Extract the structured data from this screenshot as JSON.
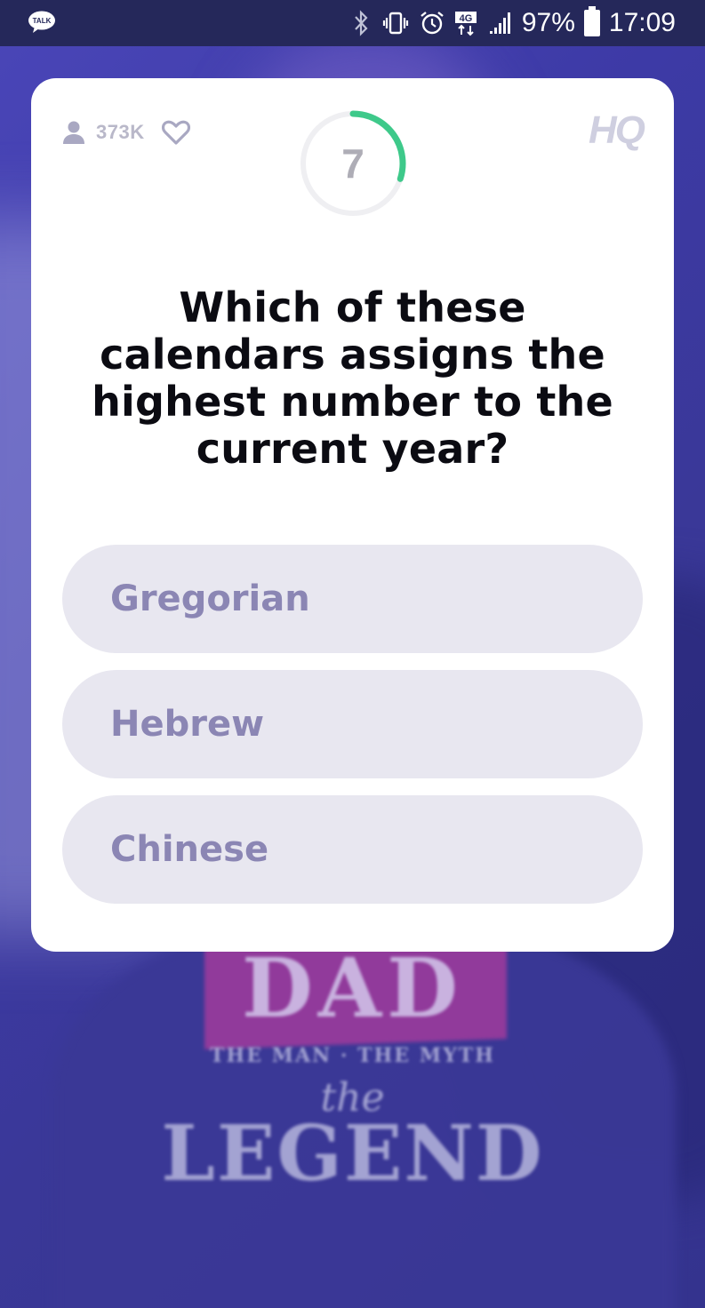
{
  "status_bar": {
    "app_icon": "kakaotalk-icon",
    "app_icon_label": "TALK",
    "icons": [
      "bluetooth-icon",
      "vibrate-icon",
      "alarm-icon",
      "4g-icon",
      "signal-icon"
    ],
    "network_label": "4G",
    "battery_percent": "97%",
    "time": "17:09"
  },
  "game": {
    "viewers": "373K",
    "timer_seconds": "7",
    "timer_progress": 0.3,
    "logo": "HQ",
    "question": "Which of these calendars assigns the highest number to the current year?",
    "answers": [
      {
        "label": "Gregorian"
      },
      {
        "label": "Hebrew"
      },
      {
        "label": "Chinese"
      }
    ]
  },
  "background": {
    "shirt_text": "DAD",
    "shirt_subtitle": "THE MAN · THE MYTH",
    "shirt_the": "the",
    "shirt_legend": "LEGEND"
  },
  "colors": {
    "accent_timer": "#3ec98a",
    "answer_bg": "#e8e7f0",
    "answer_text": "#8b86b4",
    "background": "#3d3aa6"
  }
}
